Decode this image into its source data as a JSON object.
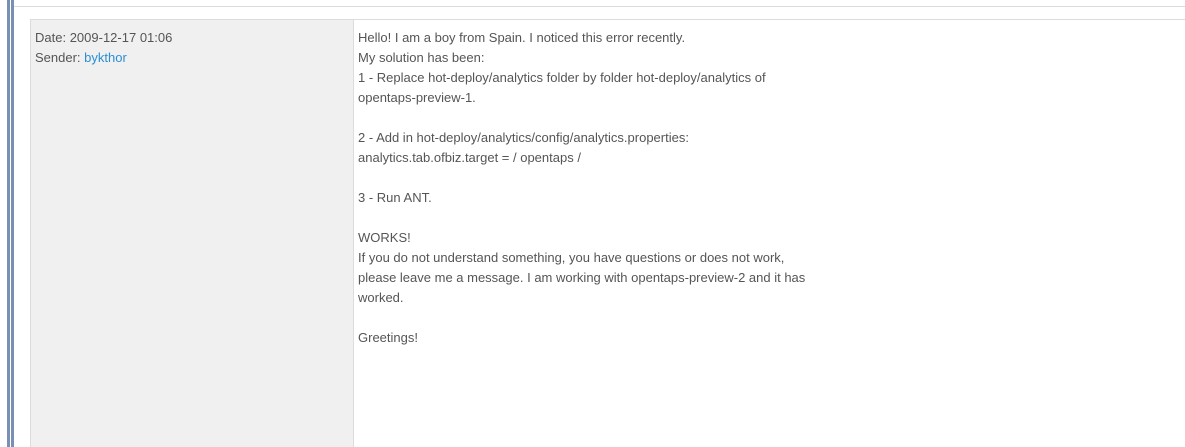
{
  "message": {
    "date_label": "Date:",
    "date_value": "2009-12-17 01:06",
    "sender_label": "Sender:",
    "sender_name": "bykthor",
    "body_lines": [
      "Hello! I am a boy from Spain. I noticed this error recently.",
      "My solution has been:",
      "1 - Replace hot-deploy/analytics folder by folder hot-deploy/analytics of",
      "opentaps-preview-1.",
      "",
      "2 - Add in hot-deploy/analytics/config/analytics.properties:",
      "analytics.tab.ofbiz.target = / opentaps /",
      "",
      "3 - Run ANT.",
      "",
      "WORKS!",
      "If you do not understand something, you have questions or does not work,",
      "please leave me a message. I am working with opentaps-preview-2 and it has",
      "worked.",
      "",
      "Greetings!"
    ]
  },
  "colors": {
    "link": "#2a8fd6",
    "meta_background": "#f0f0f0",
    "text": "#555555",
    "frame_bar": "#7a8fb4"
  }
}
